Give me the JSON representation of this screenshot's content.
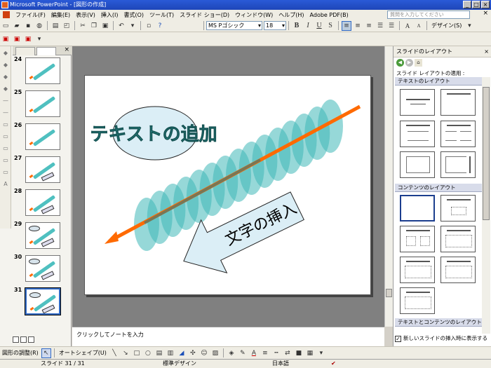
{
  "window": {
    "title": "Microsoft PowerPoint - [図形の作成]"
  },
  "menu": {
    "items": [
      "ファイル(F)",
      "編集(E)",
      "表示(V)",
      "挿入(I)",
      "書式(O)",
      "ツール(T)",
      "スライド ショー(D)",
      "ウィンドウ(W)",
      "ヘルプ(H)",
      "Adobe PDF(B)"
    ],
    "help_placeholder": "質問を入力してください"
  },
  "format_toolbar": {
    "font": "MS Pゴシック",
    "size": "18",
    "bold": "B",
    "italic": "I",
    "underline": "U",
    "shadow": "S",
    "grow": "A",
    "shrink": "A",
    "design_label": "デザイン(S)"
  },
  "thumbnails": [
    {
      "num": "24",
      "variant": "pen"
    },
    {
      "num": "25",
      "variant": "pen"
    },
    {
      "num": "26",
      "variant": "pen"
    },
    {
      "num": "27",
      "variant": "arrow"
    },
    {
      "num": "28",
      "variant": "arrow"
    },
    {
      "num": "29",
      "variant": "ellipse-arrow"
    },
    {
      "num": "30",
      "variant": "ellipse-arrow"
    },
    {
      "num": "31",
      "variant": "full",
      "selected": true
    }
  ],
  "slide": {
    "title_text": "テキストの追加",
    "arrow_text": "文字の挿入",
    "colors": {
      "ellipses": "#3fb8b8",
      "pen_line": "#ff6a00",
      "title": "#2a8a8a",
      "arrow_fill": "#dbeef6"
    }
  },
  "notes": {
    "placeholder": "クリックしてノートを入力"
  },
  "task_pane": {
    "title": "スライドのレイアウト",
    "apply_label": "スライド レイアウトの適用 :",
    "section_text": "テキストのレイアウト",
    "section_content": "コンテンツのレイアウト",
    "section_text_content": "テキストとコンテンツのレイアウト",
    "checkbox_label": "新しいスライドの挿入時に表示する",
    "checkbox_checked": true
  },
  "draw_toolbar": {
    "draw_label": "図形の調整(R)",
    "autoshape_label": "オートシェイプ(U)"
  },
  "status": {
    "slide": "スライド 31 / 31",
    "design": "標準デザイン",
    "language": "日本語"
  }
}
